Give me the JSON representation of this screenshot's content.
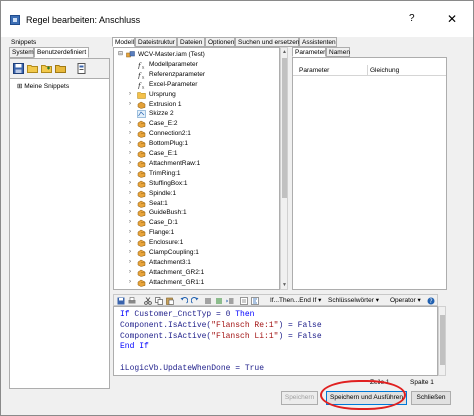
{
  "window": {
    "title": "Regel bearbeiten: Anschluss",
    "help": "?",
    "close": "✕"
  },
  "left_panel": {
    "header": "Snippets",
    "tabs": [
      {
        "label": "System",
        "selected": false
      },
      {
        "label": "Benutzerdefiniert",
        "selected": true
      }
    ],
    "tree_item": "Meine Snippets",
    "tree_expander": "⊞"
  },
  "main_tabs": [
    {
      "label": "Modell",
      "selected": true
    },
    {
      "label": "Dateistruktur",
      "selected": false
    },
    {
      "label": "Dateien",
      "selected": false
    },
    {
      "label": "Optionen",
      "selected": false
    },
    {
      "label": "Suchen und ersetzen",
      "selected": false
    },
    {
      "label": "Assistenten",
      "selected": false
    }
  ],
  "model_tree": [
    {
      "label": "WCV-Master.iam (Test)",
      "icon": "assembly-icon",
      "expander": "⊟",
      "level": 0
    },
    {
      "label": "Modellparameter",
      "icon": "fx-icon",
      "expander": "",
      "level": 1
    },
    {
      "label": "Referenzparameter",
      "icon": "fx-icon",
      "expander": "",
      "level": 1
    },
    {
      "label": "Excel-Parameter",
      "icon": "fx-icon",
      "expander": "",
      "level": 1
    },
    {
      "label": "Ursprung",
      "icon": "folder-icon",
      "expander": "›",
      "level": 1
    },
    {
      "label": "Extrusion 1",
      "icon": "extrusion-icon",
      "expander": "›",
      "level": 1
    },
    {
      "label": "Skizze 2",
      "icon": "sketch-icon",
      "expander": "",
      "level": 1
    },
    {
      "label": "Case_E:2",
      "icon": "part-icon",
      "expander": "›",
      "level": 1
    },
    {
      "label": "Connection2:1",
      "icon": "part-icon",
      "expander": "›",
      "level": 1
    },
    {
      "label": "BottomPlug:1",
      "icon": "part-icon",
      "expander": "›",
      "level": 1
    },
    {
      "label": "Case_E:1",
      "icon": "part-icon",
      "expander": "›",
      "level": 1
    },
    {
      "label": "AttachmentRaw:1",
      "icon": "part-icon",
      "expander": "›",
      "level": 1
    },
    {
      "label": "TrimRing:1",
      "icon": "part-icon",
      "expander": "›",
      "level": 1
    },
    {
      "label": "StuffingBox:1",
      "icon": "part-icon",
      "expander": "›",
      "level": 1
    },
    {
      "label": "Spindle:1",
      "icon": "part-icon",
      "expander": "›",
      "level": 1
    },
    {
      "label": "Seat:1",
      "icon": "part-icon",
      "expander": "›",
      "level": 1
    },
    {
      "label": "GuideBush:1",
      "icon": "part-icon",
      "expander": "›",
      "level": 1
    },
    {
      "label": "Case_D:1",
      "icon": "part-icon",
      "expander": "›",
      "level": 1
    },
    {
      "label": "Flange:1",
      "icon": "part-icon",
      "expander": "›",
      "level": 1
    },
    {
      "label": "Enclosure:1",
      "icon": "part-icon",
      "expander": "›",
      "level": 1
    },
    {
      "label": "ClampCoupling:1",
      "icon": "part-icon",
      "expander": "›",
      "level": 1
    },
    {
      "label": "Attachment3:1",
      "icon": "part-icon",
      "expander": "›",
      "level": 1
    },
    {
      "label": "Attachment_GR2:1",
      "icon": "part-icon",
      "expander": "›",
      "level": 1
    },
    {
      "label": "Attachment_GR1:1",
      "icon": "part-icon",
      "expander": "›",
      "level": 1
    }
  ],
  "param_panel": {
    "tabs": [
      {
        "label": "Parameter",
        "selected": true
      },
      {
        "label": "Namen",
        "selected": false
      }
    ],
    "columns": [
      "Parameter",
      "Gleichung"
    ]
  },
  "code_toolbar": {
    "if_then": "If...Then...End If",
    "keywords": "Schlüsselwörter",
    "operators": "Operator",
    "dropdown_arrow": "▾"
  },
  "code": {
    "lines": [
      [
        {
          "t": "If ",
          "c": "kw"
        },
        {
          "t": "Customer_CnctTyp = 0 ",
          "c": "ident"
        },
        {
          "t": "Then",
          "c": "kw"
        }
      ],
      [
        {
          "t": "Component.IsActive(",
          "c": "ident"
        },
        {
          "t": "\"Flansch Re:1\"",
          "c": "str"
        },
        {
          "t": ") = False",
          "c": "ident"
        }
      ],
      [
        {
          "t": "Component.IsActive(",
          "c": "ident"
        },
        {
          "t": "\"Flansch Li:1\"",
          "c": "str"
        },
        {
          "t": ") = False",
          "c": "ident"
        }
      ],
      [
        {
          "t": "End If",
          "c": "kw"
        }
      ],
      [
        {
          "t": "",
          "c": "ident"
        }
      ],
      [
        {
          "t": "iLogicVb.UpdateWhenDone = True",
          "c": "ident"
        }
      ]
    ]
  },
  "status": {
    "zeile": "Zeile 1",
    "spalte": "Spalte 1"
  },
  "buttons": {
    "save": "Speichern",
    "save_run": "Speichern und Ausführen",
    "close": "Schließen"
  },
  "colors": {
    "keyword": "#0000ff",
    "string": "#a31515",
    "annotation": "#e02020",
    "selection_border": "#0078d7"
  }
}
